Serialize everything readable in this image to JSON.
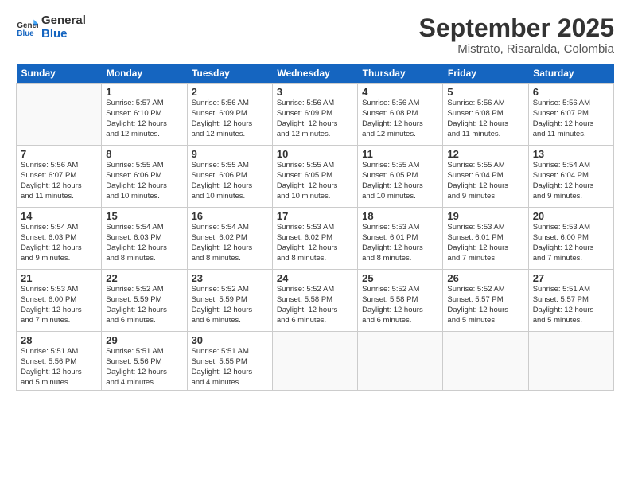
{
  "logo": {
    "line1": "General",
    "line2": "Blue"
  },
  "title": "September 2025",
  "subtitle": "Mistrato, Risaralda, Colombia",
  "headers": [
    "Sunday",
    "Monday",
    "Tuesday",
    "Wednesday",
    "Thursday",
    "Friday",
    "Saturday"
  ],
  "weeks": [
    [
      {
        "date": "",
        "lines": []
      },
      {
        "date": "1",
        "lines": [
          "Sunrise: 5:57 AM",
          "Sunset: 6:10 PM",
          "Daylight: 12 hours",
          "and 12 minutes."
        ]
      },
      {
        "date": "2",
        "lines": [
          "Sunrise: 5:56 AM",
          "Sunset: 6:09 PM",
          "Daylight: 12 hours",
          "and 12 minutes."
        ]
      },
      {
        "date": "3",
        "lines": [
          "Sunrise: 5:56 AM",
          "Sunset: 6:09 PM",
          "Daylight: 12 hours",
          "and 12 minutes."
        ]
      },
      {
        "date": "4",
        "lines": [
          "Sunrise: 5:56 AM",
          "Sunset: 6:08 PM",
          "Daylight: 12 hours",
          "and 12 minutes."
        ]
      },
      {
        "date": "5",
        "lines": [
          "Sunrise: 5:56 AM",
          "Sunset: 6:08 PM",
          "Daylight: 12 hours",
          "and 11 minutes."
        ]
      },
      {
        "date": "6",
        "lines": [
          "Sunrise: 5:56 AM",
          "Sunset: 6:07 PM",
          "Daylight: 12 hours",
          "and 11 minutes."
        ]
      }
    ],
    [
      {
        "date": "7",
        "lines": [
          "Sunrise: 5:56 AM",
          "Sunset: 6:07 PM",
          "Daylight: 12 hours",
          "and 11 minutes."
        ]
      },
      {
        "date": "8",
        "lines": [
          "Sunrise: 5:55 AM",
          "Sunset: 6:06 PM",
          "Daylight: 12 hours",
          "and 10 minutes."
        ]
      },
      {
        "date": "9",
        "lines": [
          "Sunrise: 5:55 AM",
          "Sunset: 6:06 PM",
          "Daylight: 12 hours",
          "and 10 minutes."
        ]
      },
      {
        "date": "10",
        "lines": [
          "Sunrise: 5:55 AM",
          "Sunset: 6:05 PM",
          "Daylight: 12 hours",
          "and 10 minutes."
        ]
      },
      {
        "date": "11",
        "lines": [
          "Sunrise: 5:55 AM",
          "Sunset: 6:05 PM",
          "Daylight: 12 hours",
          "and 10 minutes."
        ]
      },
      {
        "date": "12",
        "lines": [
          "Sunrise: 5:55 AM",
          "Sunset: 6:04 PM",
          "Daylight: 12 hours",
          "and 9 minutes."
        ]
      },
      {
        "date": "13",
        "lines": [
          "Sunrise: 5:54 AM",
          "Sunset: 6:04 PM",
          "Daylight: 12 hours",
          "and 9 minutes."
        ]
      }
    ],
    [
      {
        "date": "14",
        "lines": [
          "Sunrise: 5:54 AM",
          "Sunset: 6:03 PM",
          "Daylight: 12 hours",
          "and 9 minutes."
        ]
      },
      {
        "date": "15",
        "lines": [
          "Sunrise: 5:54 AM",
          "Sunset: 6:03 PM",
          "Daylight: 12 hours",
          "and 8 minutes."
        ]
      },
      {
        "date": "16",
        "lines": [
          "Sunrise: 5:54 AM",
          "Sunset: 6:02 PM",
          "Daylight: 12 hours",
          "and 8 minutes."
        ]
      },
      {
        "date": "17",
        "lines": [
          "Sunrise: 5:53 AM",
          "Sunset: 6:02 PM",
          "Daylight: 12 hours",
          "and 8 minutes."
        ]
      },
      {
        "date": "18",
        "lines": [
          "Sunrise: 5:53 AM",
          "Sunset: 6:01 PM",
          "Daylight: 12 hours",
          "and 8 minutes."
        ]
      },
      {
        "date": "19",
        "lines": [
          "Sunrise: 5:53 AM",
          "Sunset: 6:01 PM",
          "Daylight: 12 hours",
          "and 7 minutes."
        ]
      },
      {
        "date": "20",
        "lines": [
          "Sunrise: 5:53 AM",
          "Sunset: 6:00 PM",
          "Daylight: 12 hours",
          "and 7 minutes."
        ]
      }
    ],
    [
      {
        "date": "21",
        "lines": [
          "Sunrise: 5:53 AM",
          "Sunset: 6:00 PM",
          "Daylight: 12 hours",
          "and 7 minutes."
        ]
      },
      {
        "date": "22",
        "lines": [
          "Sunrise: 5:52 AM",
          "Sunset: 5:59 PM",
          "Daylight: 12 hours",
          "and 6 minutes."
        ]
      },
      {
        "date": "23",
        "lines": [
          "Sunrise: 5:52 AM",
          "Sunset: 5:59 PM",
          "Daylight: 12 hours",
          "and 6 minutes."
        ]
      },
      {
        "date": "24",
        "lines": [
          "Sunrise: 5:52 AM",
          "Sunset: 5:58 PM",
          "Daylight: 12 hours",
          "and 6 minutes."
        ]
      },
      {
        "date": "25",
        "lines": [
          "Sunrise: 5:52 AM",
          "Sunset: 5:58 PM",
          "Daylight: 12 hours",
          "and 6 minutes."
        ]
      },
      {
        "date": "26",
        "lines": [
          "Sunrise: 5:52 AM",
          "Sunset: 5:57 PM",
          "Daylight: 12 hours",
          "and 5 minutes."
        ]
      },
      {
        "date": "27",
        "lines": [
          "Sunrise: 5:51 AM",
          "Sunset: 5:57 PM",
          "Daylight: 12 hours",
          "and 5 minutes."
        ]
      }
    ],
    [
      {
        "date": "28",
        "lines": [
          "Sunrise: 5:51 AM",
          "Sunset: 5:56 PM",
          "Daylight: 12 hours",
          "and 5 minutes."
        ]
      },
      {
        "date": "29",
        "lines": [
          "Sunrise: 5:51 AM",
          "Sunset: 5:56 PM",
          "Daylight: 12 hours",
          "and 4 minutes."
        ]
      },
      {
        "date": "30",
        "lines": [
          "Sunrise: 5:51 AM",
          "Sunset: 5:55 PM",
          "Daylight: 12 hours",
          "and 4 minutes."
        ]
      },
      {
        "date": "",
        "lines": []
      },
      {
        "date": "",
        "lines": []
      },
      {
        "date": "",
        "lines": []
      },
      {
        "date": "",
        "lines": []
      }
    ]
  ]
}
